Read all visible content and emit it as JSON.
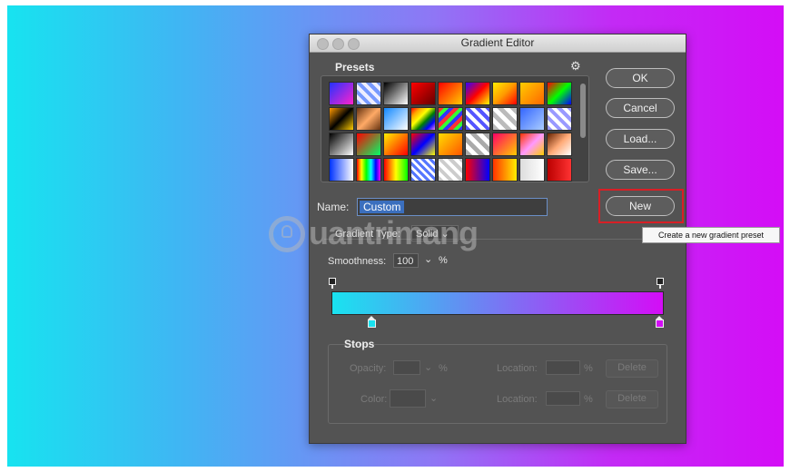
{
  "dialog": {
    "title": "Gradient Editor"
  },
  "presets": {
    "label": "Presets",
    "gear_icon": "gear-icon",
    "swatches": [
      "linear-gradient(135deg,#2233ff,#ff22cc)",
      "repeating-linear-gradient(45deg,#7799ff 0 4px,#eeeeff 4px 8px)",
      "linear-gradient(135deg,#000000,#ffffff)",
      "linear-gradient(135deg,#ff0000,#660000)",
      "linear-gradient(135deg,#ff0000,#ffcc00)",
      "linear-gradient(135deg,#3300ff,#ff0000,#ffff00)",
      "linear-gradient(135deg,#ffee00,#ff9900,#ff0000)",
      "linear-gradient(135deg,#ffcc00,#ff6600)",
      "linear-gradient(135deg,#ff0000,#00ff00,#0000ff)",
      "linear-gradient(135deg,#ff9900,#000000,#ffcc00)",
      "linear-gradient(135deg,#663311,#ffaa66,#663311)",
      "linear-gradient(135deg,#1188ff,#ffffff)",
      "linear-gradient(135deg,red,orange,yellow,green,blue,violet)",
      "repeating-linear-gradient(135deg,#ff3333 0 4px,#33ff33 4px 8px,#3333ff 8px 12px)",
      "repeating-linear-gradient(45deg,#5555ff 0 4px,#ffffff 4px 8px)",
      "repeating-linear-gradient(45deg,#bbbbbb 0 5px,#ffffff 5px 10px)",
      "linear-gradient(135deg,#3366ff,#aaccff)",
      "repeating-linear-gradient(45deg,#9999ff 0 4px,#ffffff 4px 8px)",
      "linear-gradient(135deg,#000000,#ffffff)",
      "linear-gradient(135deg,#ff0000,#00ff66)",
      "linear-gradient(135deg,#ffee00,#ff0000)",
      "linear-gradient(135deg,#ff0000,#0000ff,#ffff00)",
      "linear-gradient(135deg,#ffdd00,#ff5500)",
      "repeating-linear-gradient(45deg,#aaaaaa 0 5px,#ffffff 5px 10px)",
      "linear-gradient(135deg,#ff0066,#ffcc00)",
      "linear-gradient(135deg,#ff3300,#ff99ff,#ffcc00)",
      "linear-gradient(135deg,#662200,#ffaa77,#ffffff)",
      "linear-gradient(90deg,#0033ff,#ffffff)",
      "linear-gradient(90deg,red,yellow,lime,cyan,blue,magenta)",
      "linear-gradient(90deg,#ff0000,#ffff00,#00ff00)",
      "repeating-linear-gradient(45deg,#5577ff 0 3px,#ffffff 3px 6px)",
      "repeating-linear-gradient(45deg,#cccccc 0 4px,#ffffff 4px 8px)",
      "linear-gradient(90deg,#ff0000,#0000ff)",
      "linear-gradient(90deg,#ff3300,#ffee00)",
      "linear-gradient(90deg,#dddddd,#ffffff)",
      "linear-gradient(90deg,#bb0000,#ff3333)"
    ]
  },
  "buttons": {
    "ok": "OK",
    "cancel": "Cancel",
    "load": "Load...",
    "save": "Save...",
    "new": "New"
  },
  "tooltip": "Create a new gradient preset",
  "name": {
    "label": "Name:",
    "value": "Custom"
  },
  "gradient_type": {
    "label": "Gradient Type:",
    "value": "Solid"
  },
  "smoothness": {
    "label": "Smoothness:",
    "value": "100",
    "unit": "%"
  },
  "gradient": {
    "start_color": "#19e3f0",
    "end_color": "#d40df6"
  },
  "stops": {
    "label": "Stops",
    "opacity_label": "Opacity:",
    "opacity_unit": "%",
    "color_label": "Color:",
    "location_label": "Location:",
    "location_unit": "%",
    "delete_label": "Delete"
  },
  "watermark": "uantrimang"
}
